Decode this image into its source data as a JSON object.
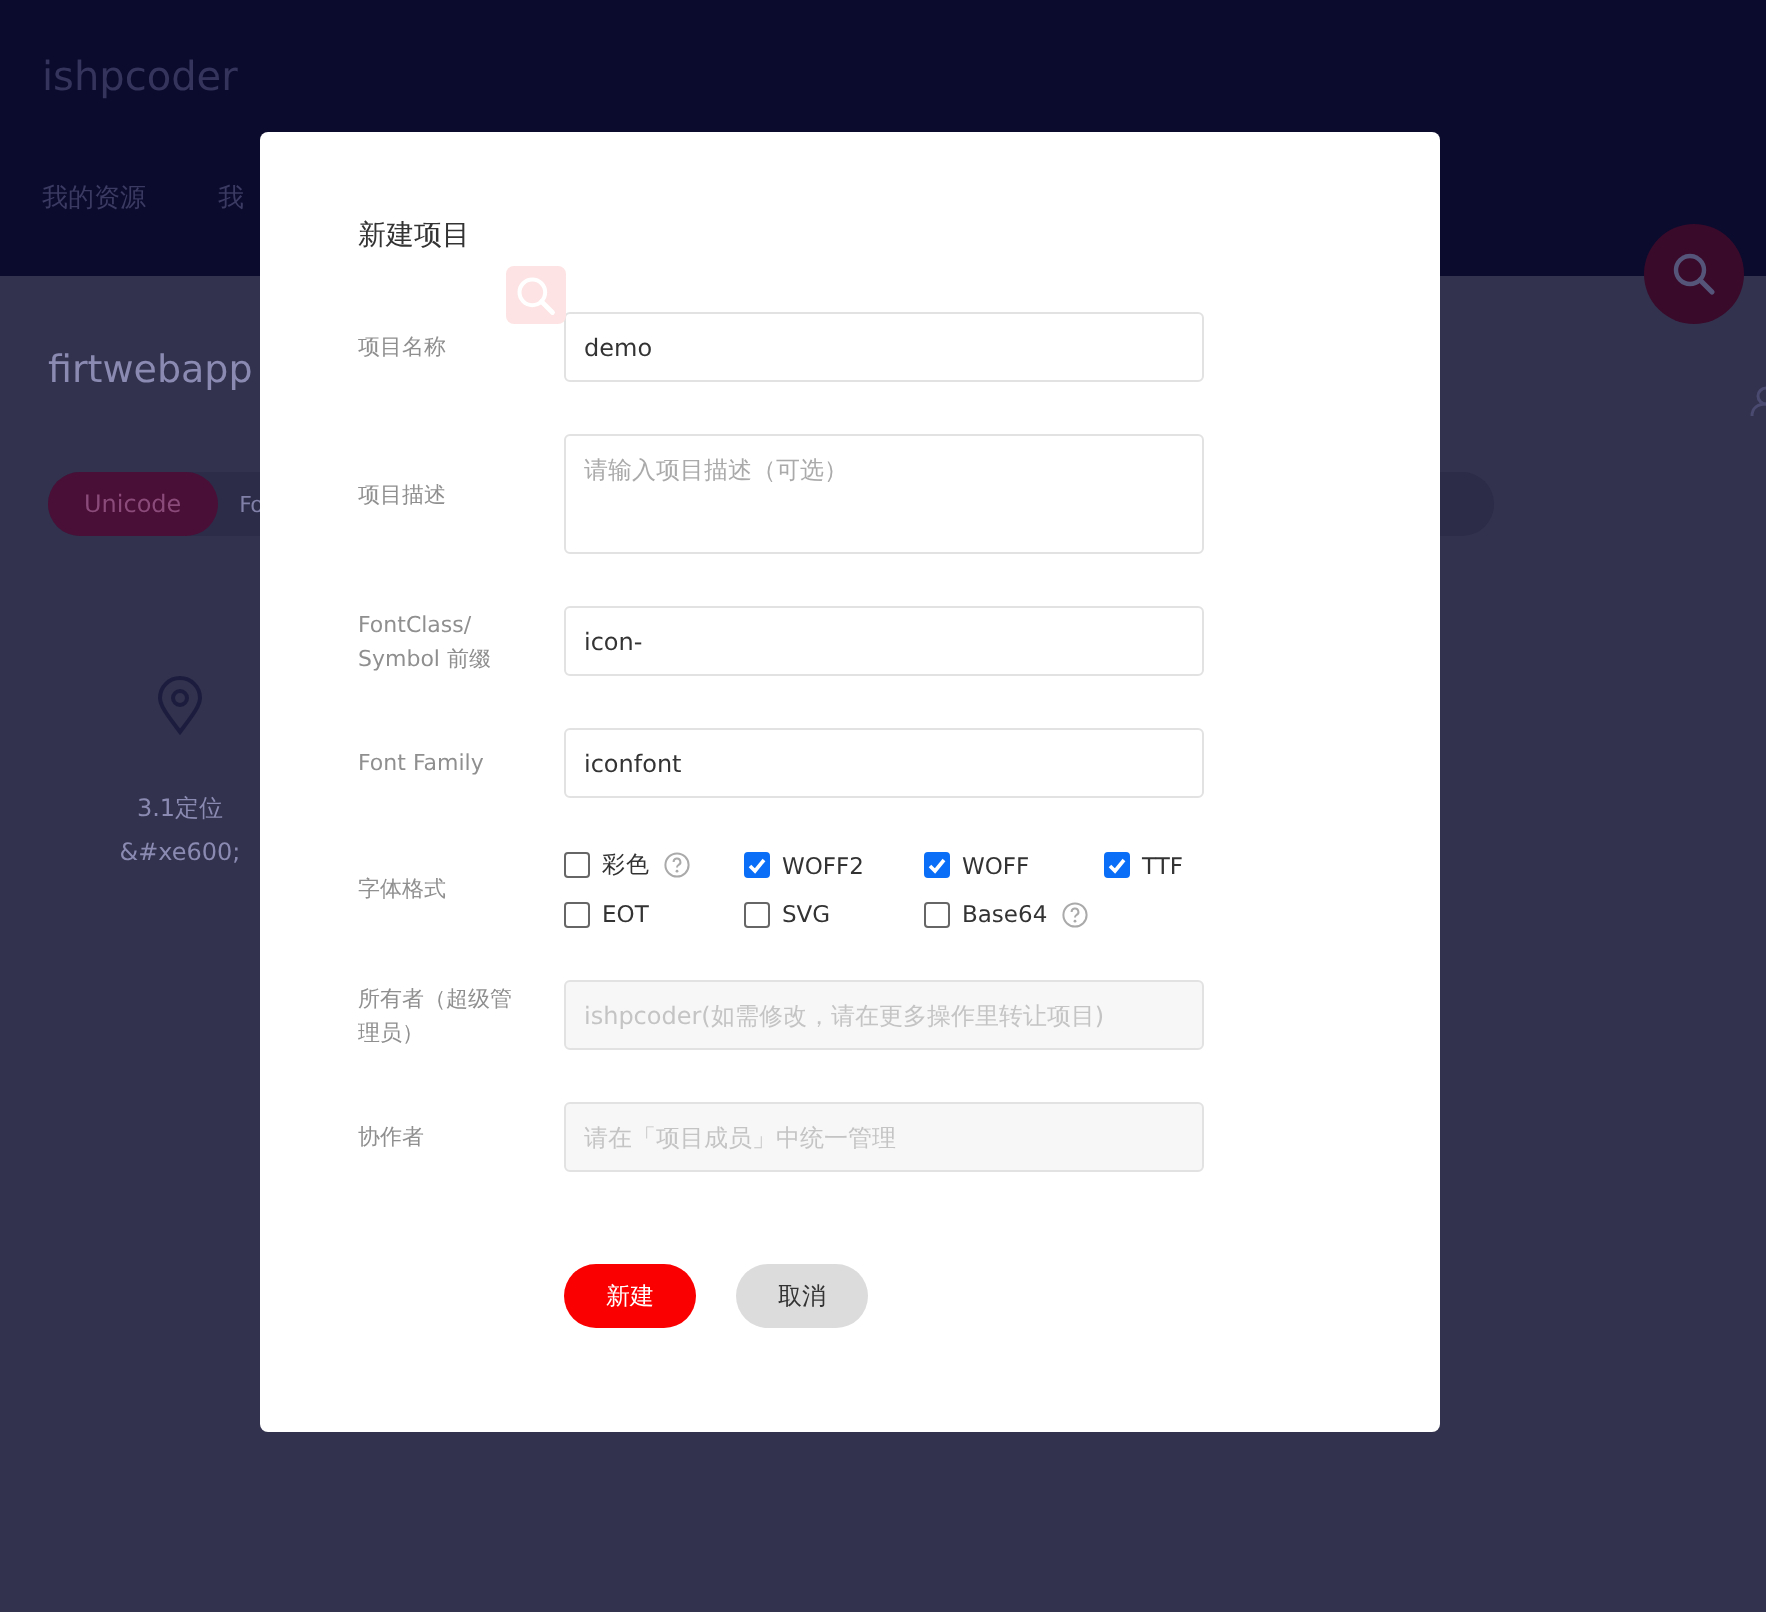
{
  "header": {
    "logo": "ishpcoder",
    "nav": [
      {
        "label": "我的资源"
      },
      {
        "label": "我"
      }
    ]
  },
  "project": {
    "title": "firtwebapp",
    "tabs": [
      {
        "label": "Unicode",
        "selected": true
      },
      {
        "label": "Fo",
        "selected": false
      }
    ]
  },
  "icons": [
    {
      "name": "3.1定位",
      "code": "&#xe600;"
    }
  ],
  "dialog": {
    "title": "新建项目",
    "fields": [
      {
        "kind": "input",
        "label": "项目名称",
        "value": "demo",
        "disabled": false
      },
      {
        "kind": "textarea",
        "label": "项目描述",
        "placeholder": "请输入项目描述（可选）"
      },
      {
        "kind": "input",
        "label": "FontClass/ Symbol 前缀",
        "value": "icon-",
        "disabled": false
      },
      {
        "kind": "input",
        "label": "Font Family",
        "value": "iconfont",
        "disabled": false
      },
      {
        "kind": "checkboxes",
        "label": "字体格式",
        "options": [
          {
            "label": "彩色",
            "checked": false,
            "help": true
          },
          {
            "label": "WOFF2",
            "checked": true,
            "help": false
          },
          {
            "label": "WOFF",
            "checked": true,
            "help": false
          },
          {
            "label": "TTF",
            "checked": true,
            "help": false
          },
          {
            "label": "EOT",
            "checked": false,
            "help": false
          },
          {
            "label": "SVG",
            "checked": false,
            "help": false
          },
          {
            "label": "Base64",
            "checked": false,
            "help": true
          }
        ]
      },
      {
        "kind": "input",
        "label": "所有者（超级管理员）",
        "placeholder": "ishpcoder(如需修改，请在更多操作里转让项目)",
        "disabled": true
      },
      {
        "kind": "input",
        "label": "协作者",
        "placeholder": "请在「项目成员」中统一管理",
        "disabled": true
      }
    ],
    "buttons": [
      {
        "label": "新建",
        "kind": "primary"
      },
      {
        "label": "取消",
        "kind": "default"
      }
    ]
  }
}
